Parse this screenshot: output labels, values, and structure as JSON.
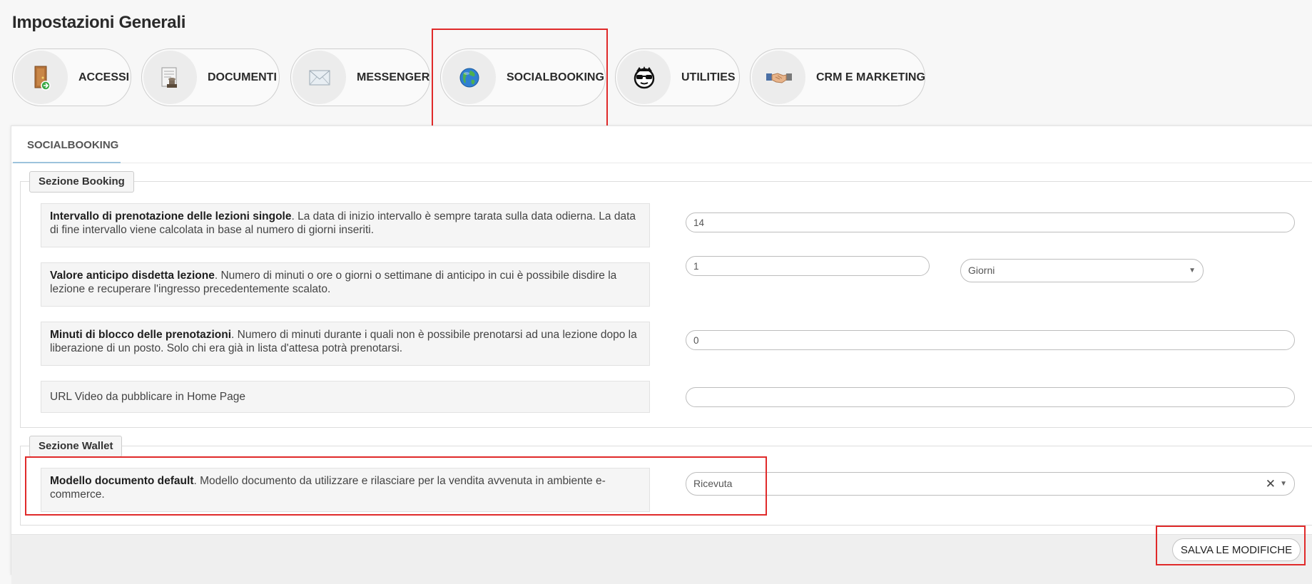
{
  "page": {
    "title": "Impostazioni Generali"
  },
  "categories": [
    {
      "label": "ACCESSI",
      "icon": "door-icon"
    },
    {
      "label": "DOCUMENTI",
      "icon": "stamp-icon"
    },
    {
      "label": "MESSENGER",
      "icon": "envelope-icon"
    },
    {
      "label": "SOCIALBOOKING",
      "icon": "globe-icon"
    },
    {
      "label": "UTILITIES",
      "icon": "sunglasses-face-icon"
    },
    {
      "label": "CRM E MARKETING",
      "icon": "handshake-icon"
    }
  ],
  "tab": {
    "label": "SOCIALBOOKING"
  },
  "booking": {
    "legend": "Sezione Booking",
    "rows": [
      {
        "title": "Intervallo di prenotazione delle lezioni singole",
        "description": ". La data di inizio intervallo è sempre tarata sulla data odierna. La data di fine intervallo viene calcolata in base al numero di giorni inseriti.",
        "value": "14"
      },
      {
        "title": "Valore anticipo disdetta lezione",
        "description": ". Numero di minuti o ore o giorni o settimane di anticipo in cui è possibile disdire la lezione e recuperare l'ingresso precedentemente scalato.",
        "value": "1",
        "unit": "Giorni"
      },
      {
        "title": "Minuti di blocco delle prenotazioni",
        "description": ". Numero di minuti durante i quali non è possibile prenotarsi ad una lezione dopo la liberazione di un posto. Solo chi era già in lista d'attesa potrà prenotarsi.",
        "value": "0"
      },
      {
        "title": "",
        "description": "URL Video da pubblicare in Home Page",
        "value": ""
      }
    ]
  },
  "wallet": {
    "legend": "Sezione Wallet",
    "row": {
      "title": "Modello documento default",
      "description": ". Modello documento da utilizzare e rilasciare per la vendita avvenuta in ambiente e-commerce.",
      "value": "Ricevuta"
    }
  },
  "actions": {
    "save_label": "SALVA LE MODIFICHE"
  },
  "colors": {
    "highlight": "#e02a2a",
    "tab_underline": "#9cc3dc"
  }
}
